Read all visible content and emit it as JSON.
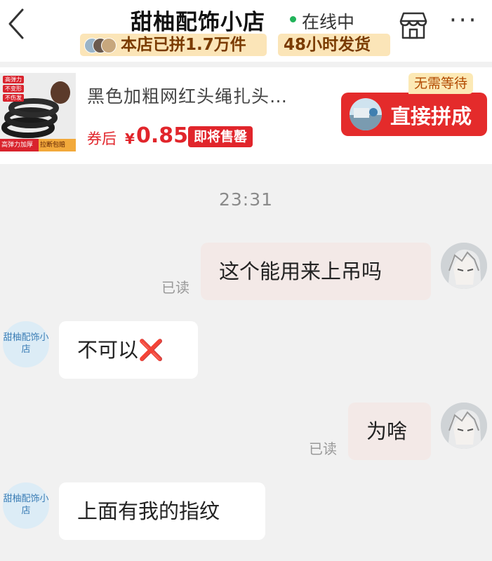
{
  "header": {
    "shop_name": "甜柚配饰小店",
    "status": "在线中",
    "group_badge": "本店已拼1.7万件",
    "ship_badge": "48小时发货",
    "more": "···"
  },
  "product": {
    "tags": [
      "高弹力",
      "不变形",
      "不伤发"
    ],
    "strip_left": "高弹力加厚",
    "strip_right": "拉断包赔",
    "name": "黑色加粗网红头绳扎头…",
    "price_label": "券后",
    "currency": "¥",
    "price": "0.85",
    "soldout_badge": "即将售罄",
    "nowait_badge": "无需等待",
    "join_button": "直接拼成"
  },
  "chat": {
    "timestamp": "23:31",
    "shop_avatar_text": "甜柚配饰小店",
    "messages": [
      {
        "from": "user",
        "text": "这个能用来上吊吗",
        "status": "已读"
      },
      {
        "from": "shop",
        "text": "不可以",
        "emoji": "❌"
      },
      {
        "from": "user",
        "text": "为啥",
        "status": "已读"
      },
      {
        "from": "shop",
        "text": "上面有我的指纹"
      }
    ]
  },
  "colors": {
    "accent_red": "#e1252b",
    "badge_bg": "#fbe5b8",
    "online_green": "#21b35a",
    "outgoing_bubble": "#f3e9e7"
  },
  "icons": [
    "back-chevron-icon",
    "store-icon",
    "more-icon"
  ]
}
